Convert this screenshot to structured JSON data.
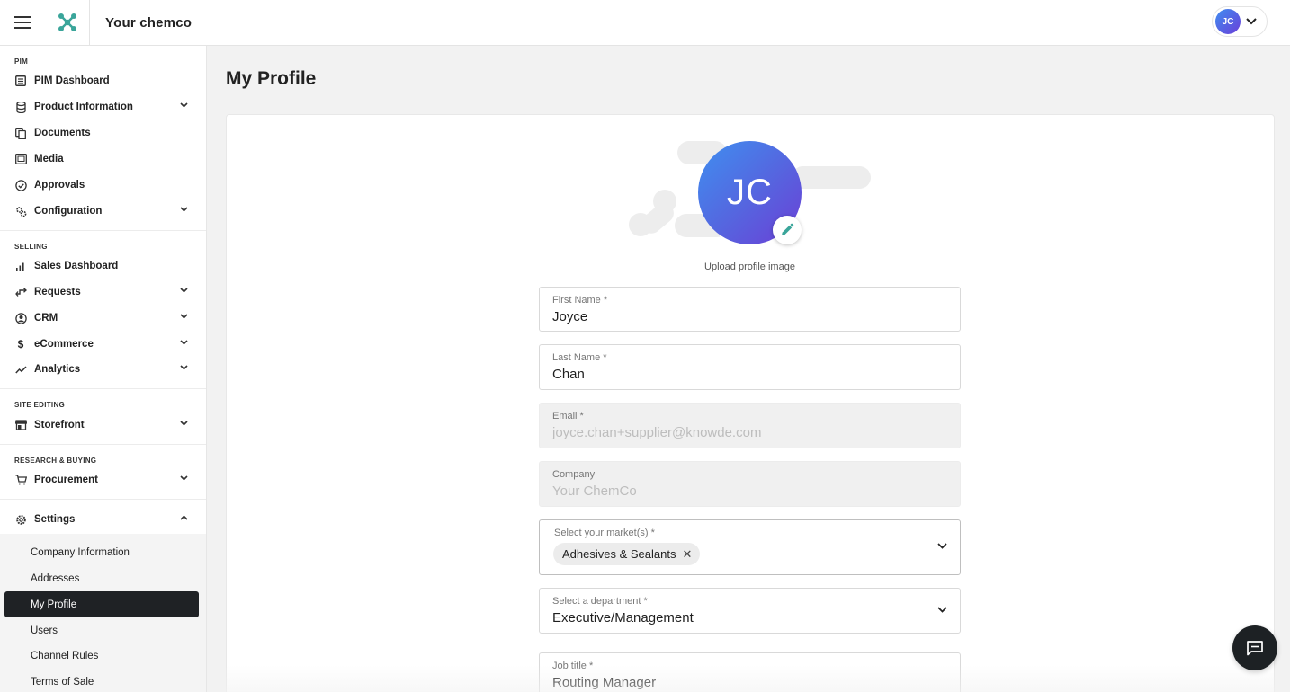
{
  "header": {
    "title": "Your chemco",
    "user_initials": "JC"
  },
  "sidebar": {
    "sections": {
      "pim": "PIM",
      "selling": "SELLING",
      "site_editing": "SITE EDITING",
      "research": "RESEARCH & BUYING"
    },
    "items": {
      "pim_dashboard": "PIM Dashboard",
      "product_information": "Product Information",
      "documents": "Documents",
      "media": "Media",
      "approvals": "Approvals",
      "configuration": "Configuration",
      "sales_dashboard": "Sales Dashboard",
      "requests": "Requests",
      "crm": "CRM",
      "ecommerce": "eCommerce",
      "analytics": "Analytics",
      "storefront": "Storefront",
      "procurement": "Procurement",
      "settings": "Settings"
    },
    "settings_sub": {
      "company_information": "Company Information",
      "addresses": "Addresses",
      "my_profile": "My Profile",
      "users": "Users",
      "channel_rules": "Channel Rules",
      "terms_of_sale": "Terms of Sale"
    }
  },
  "main": {
    "page_title": "My Profile",
    "avatar_initials": "JC",
    "upload_label": "Upload profile image",
    "form": {
      "first_name": {
        "label": "First Name *",
        "value": "Joyce"
      },
      "last_name": {
        "label": "Last Name *",
        "value": "Chan"
      },
      "email": {
        "label": "Email *",
        "value": "joyce.chan+supplier@knowde.com"
      },
      "company": {
        "label": "Company",
        "value": "Your ChemCo"
      },
      "markets": {
        "label": "Select your market(s) *",
        "chip": "Adhesives & Sealants"
      },
      "department": {
        "label": "Select a department *",
        "value": "Executive/Management"
      },
      "job_title": {
        "label": "Job title *",
        "value": "Routing Manager"
      }
    }
  },
  "colors": {
    "accent_teal": "#3aa59a",
    "active_nav_bg": "#1f2225",
    "avatar_gradient_start": "#3f8ff0",
    "avatar_gradient_end": "#6b3fd6"
  },
  "icons": {
    "menu": "hamburger-icon",
    "logo": "logo-icon",
    "edit": "pencil-icon",
    "chat": "chat-icon"
  }
}
